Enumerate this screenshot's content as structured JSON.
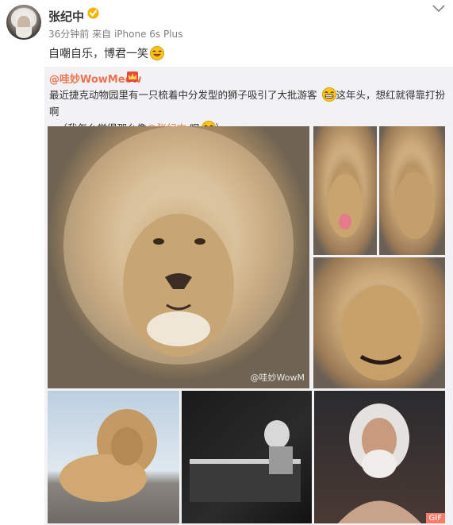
{
  "post": {
    "user": "张纪中",
    "time": "36分钟前",
    "source_prefix": "来自",
    "device": "iPhone 6s Plus",
    "text": "自嘲自乐，博君一笑"
  },
  "repost": {
    "user": "@哇妙WowMeow",
    "line1": "最近捷克动物园里有一只梳着中分发型的狮子吸引了大批游客",
    "line1_tail": "这年头，想红就得靠打扮啊",
    "line2_prefix": "~（我怎么觉得那么像",
    "mention": "@张纪中",
    "line2_suffix": "呢",
    "line2_end": "）"
  },
  "images": {
    "watermark": "@哇妙WowM",
    "gif_badge": "GIF"
  },
  "colors": {
    "accent": "#eb7350",
    "repost_bg": "#f2f2f5",
    "meta": "#808080"
  },
  "icons": [
    "verified-icon",
    "chevron-down-icon",
    "laugh-emoji-icon",
    "crown-icon",
    "grin-emoji-icon"
  ]
}
